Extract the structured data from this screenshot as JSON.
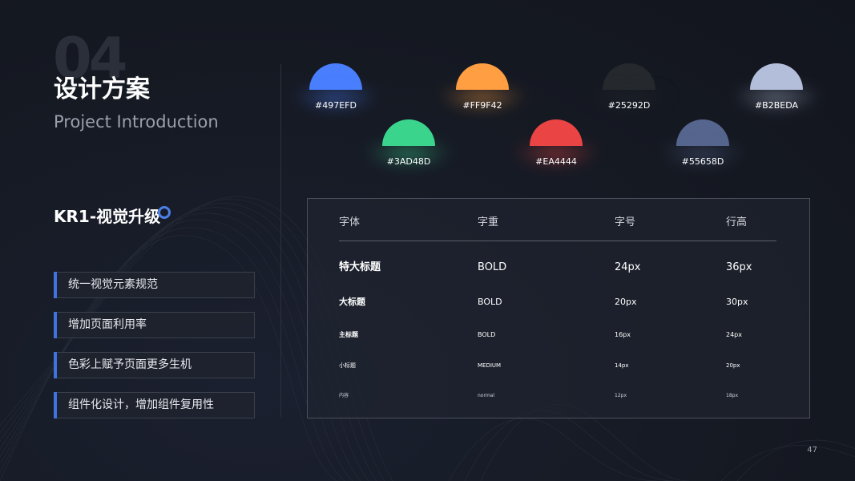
{
  "header": {
    "number": "04",
    "title": "设计方案",
    "subtitle": "Project Introduction"
  },
  "kr": {
    "title": "KR1-视觉升级"
  },
  "goals": [
    {
      "label": "统一视觉元素规范"
    },
    {
      "label": "增加页面利用率"
    },
    {
      "label": "色彩上赋予页面更多生机"
    },
    {
      "label": "组件化设计，增加组件复用性"
    }
  ],
  "palette": [
    {
      "hex": "#497EFD",
      "label": "#497EFD"
    },
    {
      "hex": "#FF9F42",
      "label": "#FF9F42"
    },
    {
      "hex": "#25292D",
      "label": "#25292D"
    },
    {
      "hex": "#B2BEDA",
      "label": "#B2BEDA"
    },
    {
      "hex": "#3AD48D",
      "label": "#3AD48D"
    },
    {
      "hex": "#EA4444",
      "label": "#EA4444"
    },
    {
      "hex": "#55658D",
      "label": "#55658D"
    }
  ],
  "typography": {
    "headers": [
      "字体",
      "字重",
      "字号",
      "行高"
    ],
    "rows": [
      [
        "特大标题",
        "BOLD",
        "24px",
        "36px"
      ],
      [
        "大标题",
        "BOLD",
        "20px",
        "30px"
      ],
      [
        "主标题",
        "BOLD",
        "16px",
        "24px"
      ],
      [
        "小标题",
        "MEDIUM",
        "14px",
        "20px"
      ],
      [
        "内容",
        "normal",
        "12px",
        "18px"
      ]
    ]
  },
  "footer": {
    "page": "47"
  },
  "colors": {
    "background": "#151922",
    "accent": "#3f73e0"
  }
}
